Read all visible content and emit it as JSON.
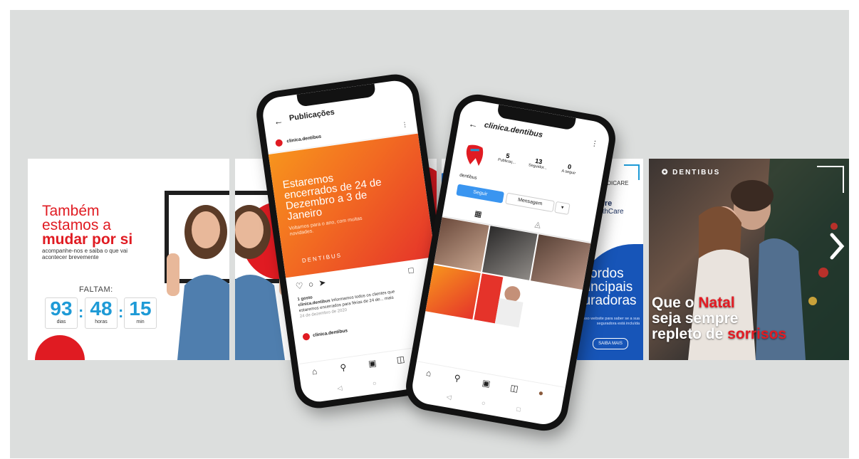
{
  "panel1": {
    "headline_line1": "Também",
    "headline_line2": "estamos a",
    "headline_line3": "mudar por si",
    "subtitle": "acompanhe-nos e saiba o que vai acontecer brevemente",
    "faltam": "FALTAM:",
    "countdown": [
      {
        "value": "93",
        "unit": "dias"
      },
      {
        "value": "48",
        "unit": "horas"
      },
      {
        "value": "15",
        "unit": "min"
      }
    ]
  },
  "phone1": {
    "title": "Publicações",
    "account": "clinica.dentibus",
    "post_title": "Estaremos encerrados de 24 de Dezembro a 3 de Janeiro",
    "post_subtitle": "Voltamos para o ano, com muitas novidades.",
    "post_logo": "DENTIBUS",
    "likes": "1 gosto",
    "caption_account": "clinica.dentibus",
    "caption_text": "Informamos todos os clientes que estaremos encerrados para férias de 24 de... mais",
    "date": "24 de dezembro de 2020",
    "comment_account": "clinica.dentibus"
  },
  "phone2": {
    "account": "clinica.dentibus",
    "stats": [
      {
        "value": "5",
        "label": "Publicaç..."
      },
      {
        "value": "13",
        "label": "Seguidor..."
      },
      {
        "value": "0",
        "label": "A seguir"
      }
    ],
    "name": "dentibus",
    "follow": "Seguir",
    "message": "Mensagem"
  },
  "panel3": {
    "brand1": "MEDICARE",
    "brand2_line1": "Future",
    "brand2_line2": "HealthCare",
    "headline_line1": "acordos",
    "headline_line2": "principais",
    "headline_line3": "guradoras",
    "note": "nosso website para saber se a sua seguradora está incluída",
    "cta": "SAIBA MAIS"
  },
  "panel4": {
    "logo": "DENTIBUS",
    "line1_a": "Que o ",
    "line1_b": "Natal",
    "line2": "seja sempre",
    "line3_a": "repleto de ",
    "line3_b": "sorrisos"
  },
  "colors": {
    "accent_red": "#e01b22",
    "accent_blue": "#1e9ad6",
    "orange": "#f26a22",
    "background": "#dcdedd"
  }
}
